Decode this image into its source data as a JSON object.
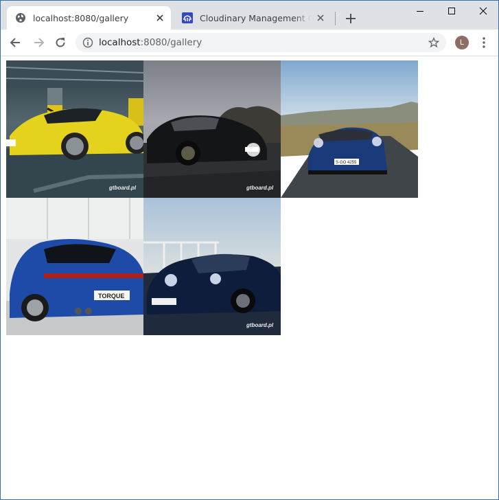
{
  "browser": {
    "tabs": [
      {
        "title": "localhost:8080/gallery",
        "active": true
      },
      {
        "title": "Cloudinary Management Console - Med",
        "active": false
      }
    ],
    "address": {
      "host": "localhost",
      "path": ":8080/gallery"
    },
    "profile_initial": "L"
  },
  "gallery": {
    "images": [
      {
        "name": "yellow-porsche-parking-garage",
        "watermark": ""
      },
      {
        "name": "black-porsche-911-cloudy",
        "watermark": "gtboard.pl"
      },
      {
        "name": "blue-porsche-911-cabriolet-road",
        "watermark": "S·GO 4255"
      },
      {
        "name": "blue-porsche-911-rear-studio",
        "watermark": "TORQUE"
      },
      {
        "name": "dark-blue-porsche-track",
        "watermark": "gtboard.pl"
      }
    ],
    "watermark_1": "gtboard.pl",
    "watermark_2": "gtboard.pl",
    "watermark_4": "gtboard.pl"
  },
  "colors": {
    "tabstrip": "#dee1e6",
    "accent_blue": "#1a73e8"
  }
}
